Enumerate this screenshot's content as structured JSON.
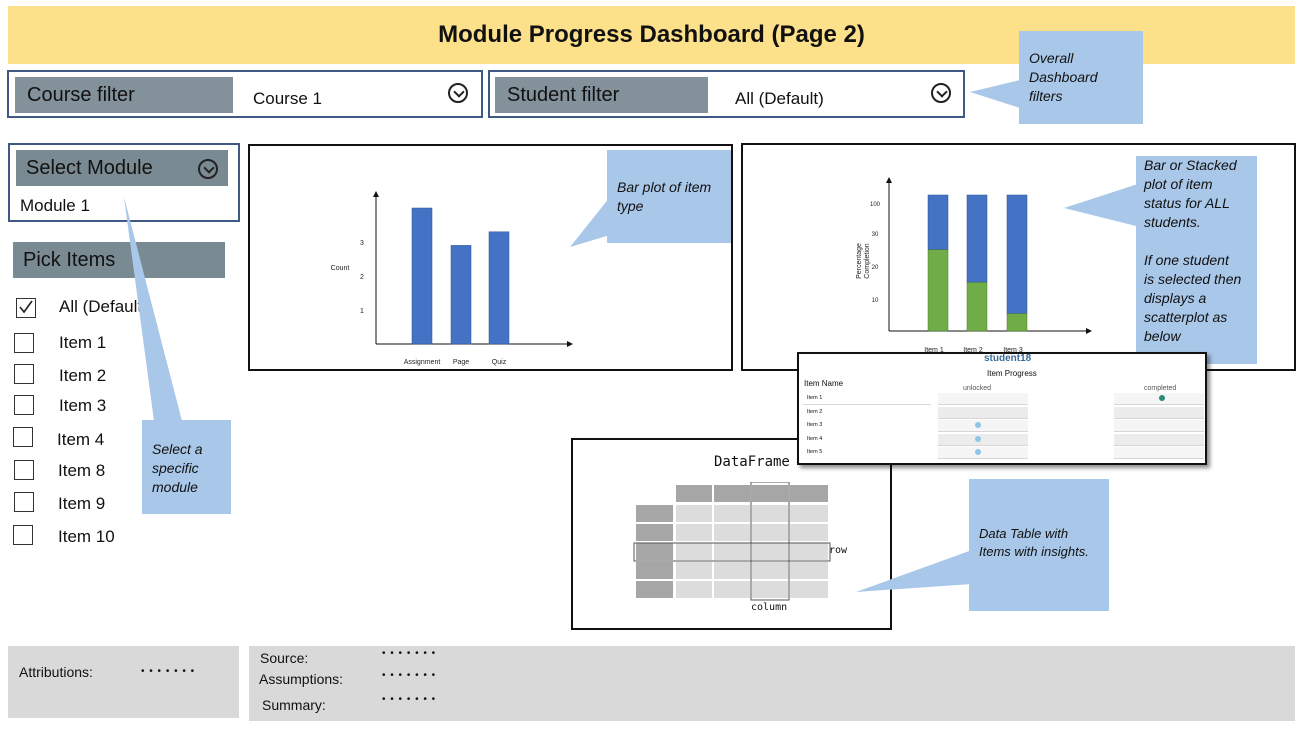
{
  "header": {
    "title": "Module Progress Dashboard (Page 2)"
  },
  "filters": {
    "course": {
      "label": "Course filter",
      "value": "Course 1"
    },
    "student": {
      "label": "Student filter",
      "value": "All (Default)"
    },
    "callout": [
      "Overall",
      "Dashboard",
      "filters"
    ]
  },
  "left": {
    "select_module": {
      "label": "Select Module",
      "value": "Module 1"
    },
    "pick_items": {
      "label": "Pick Items",
      "items": [
        "All (Default)",
        "Item 1",
        "Item 2",
        "Item 3",
        "Item 4",
        "Item 8",
        "Item 9",
        "Item 10"
      ]
    },
    "callout": [
      "Select a",
      "specific",
      "module"
    ]
  },
  "bar_plot": {
    "callout": [
      "Bar plot of item",
      "type"
    ],
    "chart_data": {
      "type": "bar",
      "categories": [
        "Assignment",
        "Page",
        "Quiz"
      ],
      "values": [
        4,
        2.9,
        3.3
      ],
      "ylabel": "Count",
      "yticks": [
        "1",
        "2",
        "3"
      ],
      "ylim": [
        0,
        4.5
      ]
    }
  },
  "stacked_plot": {
    "callout": [
      "Bar or Stacked",
      "plot of  item",
      "status for ALL",
      "students.",
      "",
      "If one student",
      "is selected then",
      "displays a",
      "scatterplot as",
      "below"
    ],
    "chart_data": {
      "type": "bar",
      "categories": [
        "Item 1",
        "Item 2",
        "Item 3"
      ],
      "series": [
        {
          "values": [
            60,
            36,
            13
          ]
        },
        {
          "values": [
            40,
            64,
            87
          ]
        }
      ],
      "ylabel": "Percentage Completion",
      "yticks": [
        "10",
        "20",
        "30",
        "100"
      ]
    },
    "colors": {
      "green": "#70ad47",
      "blue": "#4472c4"
    }
  },
  "scatter": {
    "student": "student18",
    "title": "Item Progress",
    "row_header": "Item Name",
    "col_unlocked": "unlocked",
    "col_completed": "completed",
    "rows": [
      {
        "name": "Item 1",
        "status": "completed"
      },
      {
        "name": "Item 2",
        "status": ""
      },
      {
        "name": "Item 3",
        "status": "unlocked"
      },
      {
        "name": "Item 4",
        "status": "unlocked"
      },
      {
        "name": "Item 5",
        "status": "unlocked"
      }
    ]
  },
  "dataframe": {
    "title": "DataFrame",
    "row_label": "row",
    "column_label": "column",
    "callout": [
      "Data Table with",
      "Items with insights."
    ]
  },
  "footer": {
    "attributions_label": "Attributions:",
    "attributions_value": "• • • • • • •",
    "source_label": "Source:",
    "source_value": "• • • • • • •",
    "assumptions_label": "Assumptions:",
    "assumptions_value": "• • • • • • •",
    "summary_label": "Summary:",
    "summary_value": "• • • • • • •"
  }
}
